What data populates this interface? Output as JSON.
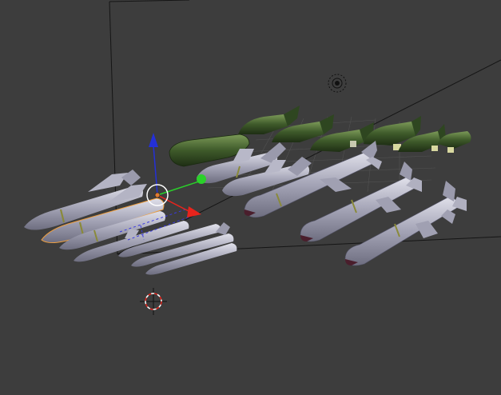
{
  "viewport": {
    "background": "#3d3d3d",
    "grid_color": "#555555",
    "line_color": "#111111",
    "selection_outline": "#f0a040"
  },
  "gizmo": {
    "x_axis_color": "#e8241c",
    "y_axis_color": "#2ad12a",
    "z_axis_color": "#2430d8",
    "pivot_ring_color": "#ffffff",
    "pivot_fill": "#e07a30"
  },
  "icons": {
    "lamp": "lamp-object-icon",
    "cursor_3d": "3d-cursor-icon"
  },
  "objects": {
    "missile_color": "#a8a8b8",
    "missile_highlight": "#d6d6e2",
    "band_color": "#8a8a3a",
    "bomb_color": "#3e5a2a",
    "bomb_highlight": "#6a8a48",
    "fuse_color": "#d8d8a0",
    "nose_color": "#4a1e2c"
  }
}
